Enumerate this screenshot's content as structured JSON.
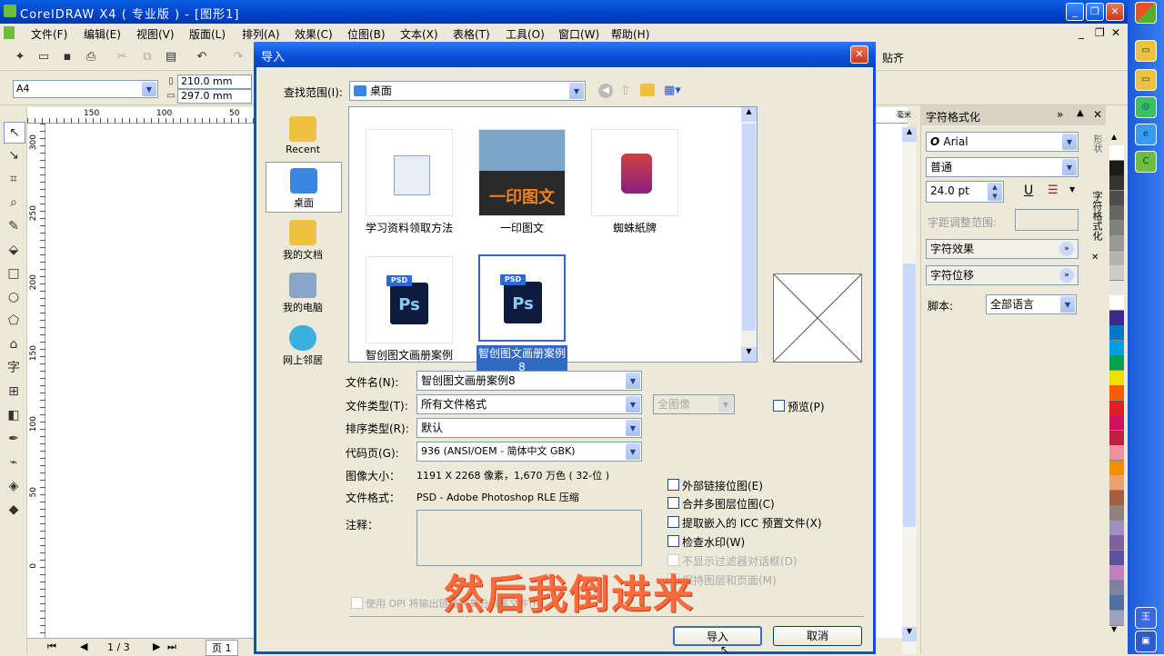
{
  "app": {
    "title": "CorelDRAW X4 ( 专业版 ) - [图形1]",
    "menu": [
      "文件(F)",
      "编辑(E)",
      "视图(V)",
      "版面(L)",
      "排列(A)",
      "效果(C)",
      "位图(B)",
      "文本(X)",
      "表格(T)",
      "工具(O)",
      "窗口(W)",
      "帮助(H)"
    ],
    "toolbar_extra": "贴齐",
    "paper_size": "A4",
    "width": "210.0 mm",
    "height": "297.0 mm",
    "ruler_h": [
      "150",
      "100",
      "50"
    ],
    "ruler_v": [
      "300",
      "250",
      "200",
      "150",
      "100",
      "50",
      "0"
    ],
    "page_count": "1 / 3",
    "page_tab": "页 1",
    "ruler_unit": "毫米"
  },
  "docker": {
    "title": "字符格式化",
    "font": "Arial",
    "style": "普通",
    "size": "24.0 pt",
    "range_label": "字距调整范围:",
    "effects": "字符效果",
    "shift": "字符位移",
    "script_label": "脚本:",
    "script_value": "全部语言",
    "side_tab_1": "字符格式化",
    "side_tab_2": "形状"
  },
  "palette": [
    "#ffffff",
    "#1a1a1a",
    "#333333",
    "#4d4d4d",
    "#666666",
    "#808080",
    "#999999",
    "#b3b3b3",
    "#cccccc",
    "#e6e6e6",
    "#ffffff",
    "#3a2a8a",
    "#0078c8",
    "#00a0e0",
    "#00a050",
    "#f0e000",
    "#f06000",
    "#e02020",
    "#d01060",
    "#c02040",
    "#f090a0",
    "#f09000",
    "#f0a070",
    "#a06040",
    "#908080",
    "#a090c0",
    "#8060a0",
    "#6050a0",
    "#c080c0",
    "#8080a0",
    "#5070a0",
    "#a0a0c0"
  ],
  "dialog": {
    "title": "导入",
    "lookin_label": "查找范围(I):",
    "lookin_value": "桌面",
    "places": [
      "Recent",
      "桌面",
      "我的文档",
      "我的电脑",
      "网上邻居"
    ],
    "files": [
      {
        "name": "学习资料领取方法"
      },
      {
        "name": "一印图文",
        "thumb_text": "一印图文"
      },
      {
        "name": "蜘蛛紙牌"
      },
      {
        "name": "智创图文画册案例"
      },
      {
        "name": "智创图文画册案例8"
      }
    ],
    "filename_label": "文件名(N):",
    "filename_value": "智创图文画册案例8",
    "filetype_label": "文件类型(T):",
    "filetype_value": "所有文件格式",
    "fullimage_value": "全图像",
    "preview_label": "预览(P)",
    "sort_label": "排序类型(R):",
    "sort_value": "默认",
    "codepage_label": "代码页(G):",
    "codepage_value": "936  (ANSI/OEM - 简体中文 GBK)",
    "imagesize_label": "图像大小：",
    "imagesize_value": "1191 X 2268 像素，1,670 万色 ( 32-位 )",
    "format_label": "文件格式：",
    "format_value": "PSD - Adobe Photoshop RLE 压缩",
    "notes_label": "注释：",
    "options": [
      {
        "label": "外部链接位图(E)",
        "enabled": true
      },
      {
        "label": "合并多图层位图(C)",
        "enabled": true
      },
      {
        "label": "提取嵌入的 ICC 预置文件(X)",
        "enabled": true
      },
      {
        "label": "检查水印(W)",
        "enabled": true
      },
      {
        "label": "不显示过滤器对话框(D)",
        "enabled": false
      },
      {
        "label": "保持图层和页面(M)",
        "enabled": false
      }
    ],
    "opi_label": "使用 OPI 将输出链接到高分辨率文件(H)",
    "import_button": "导入",
    "cancel_button": "取消"
  },
  "caption": "然后我倒进来"
}
